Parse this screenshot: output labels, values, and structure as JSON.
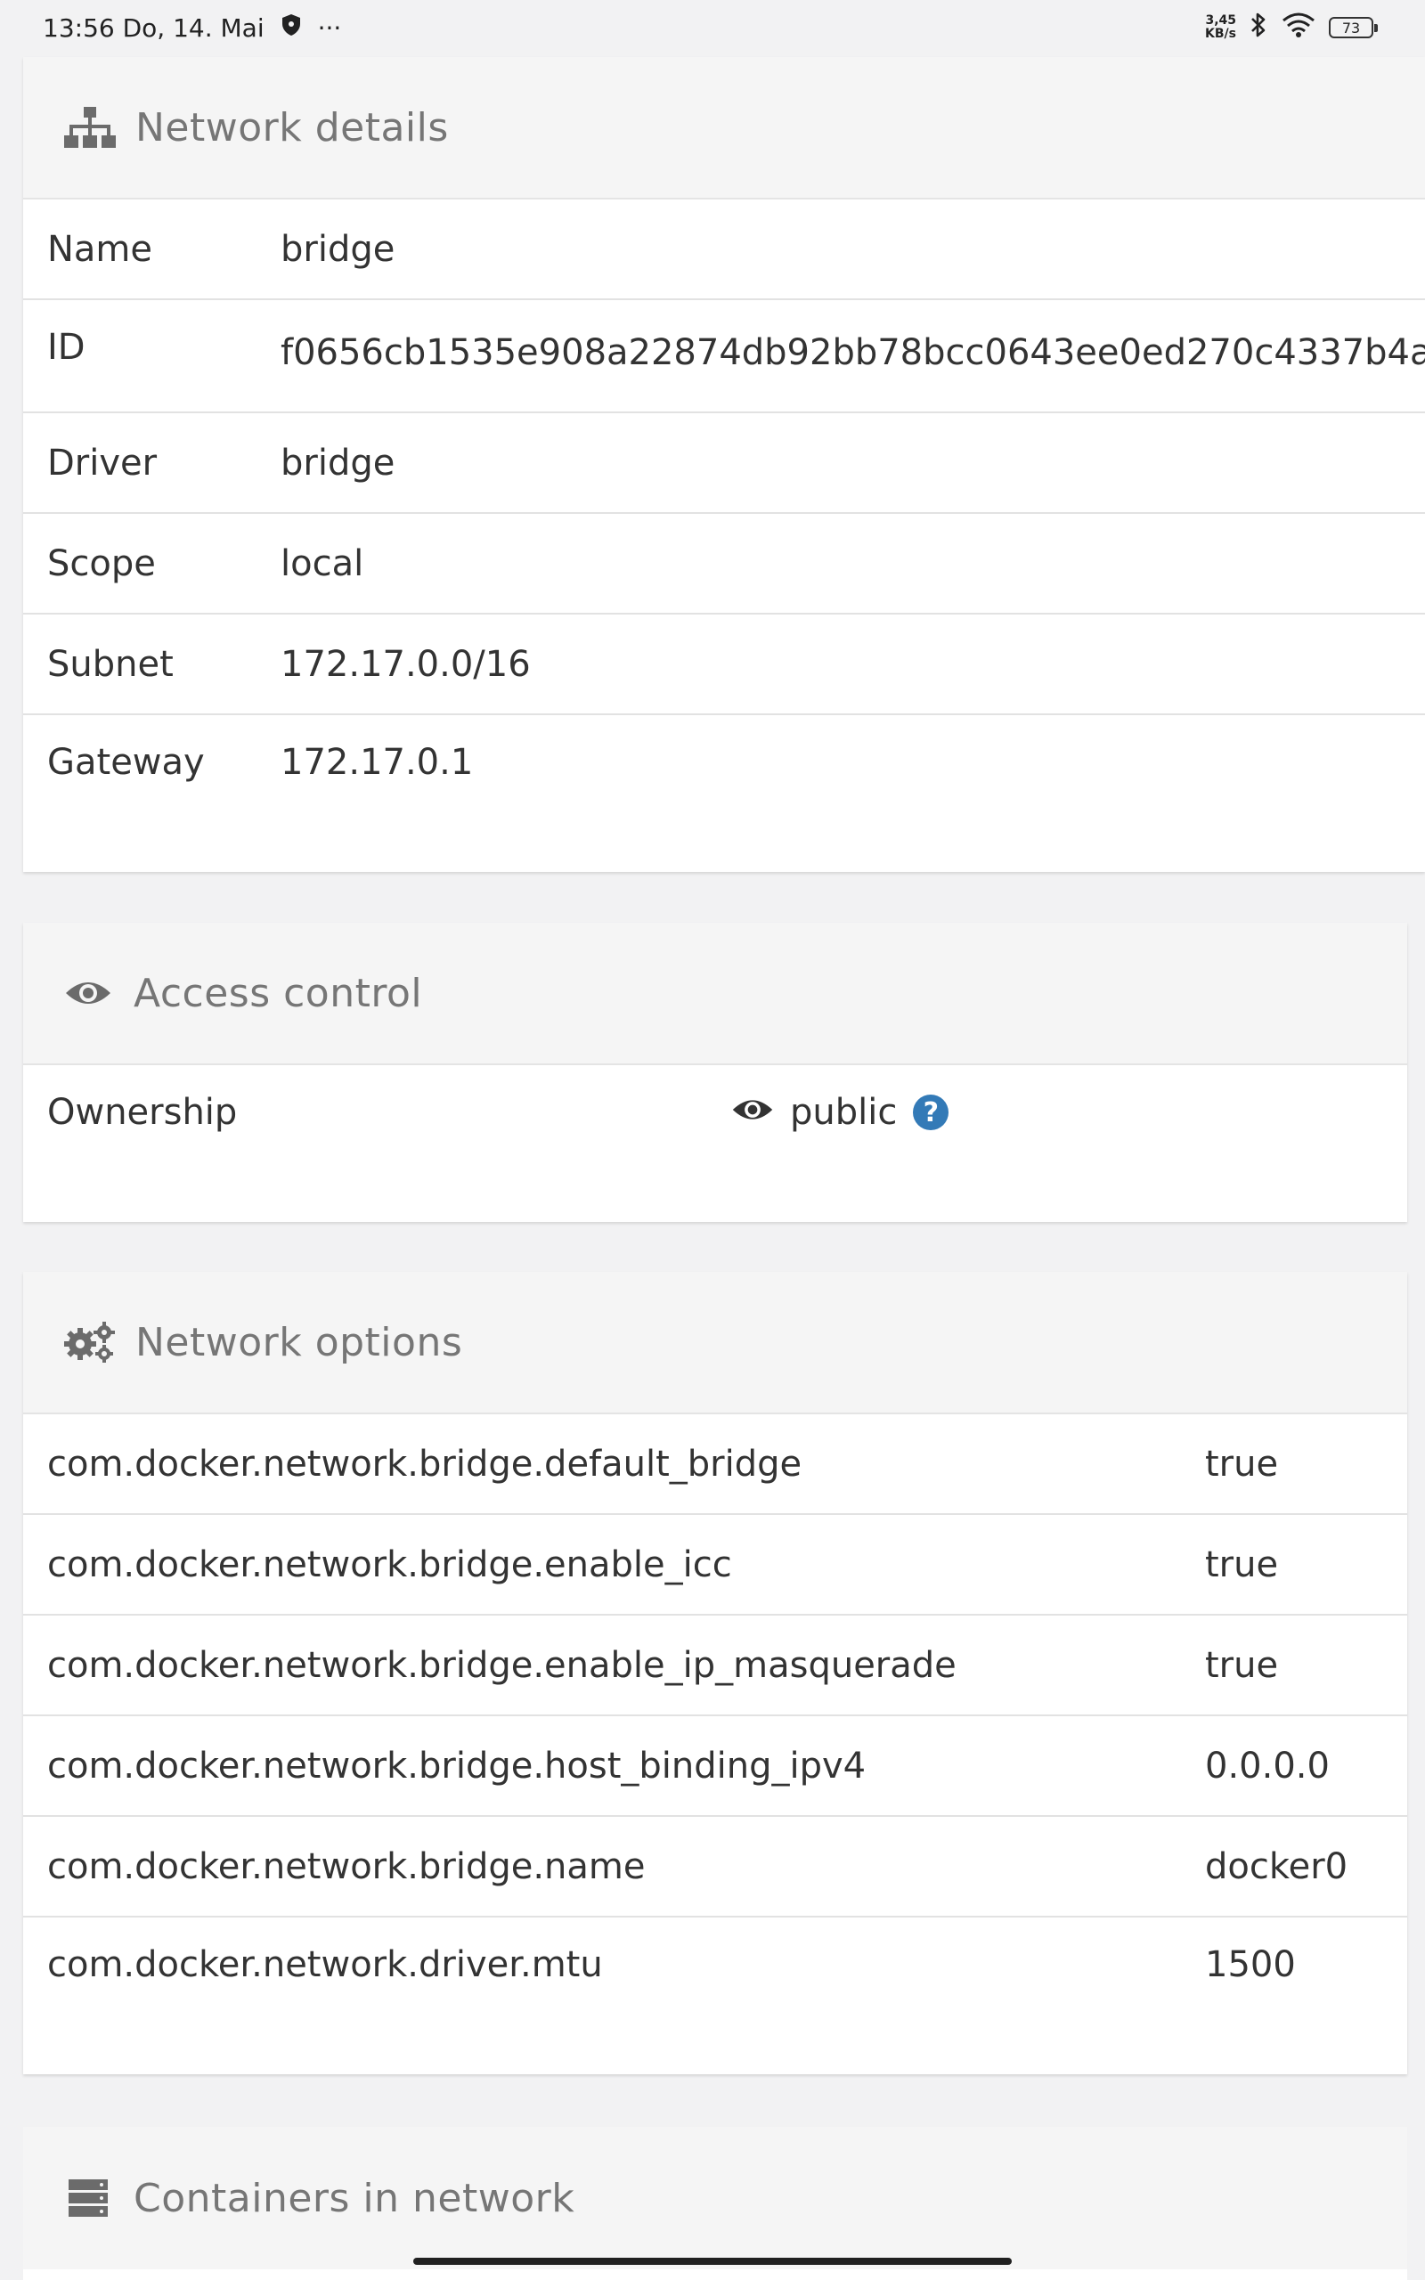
{
  "status_bar": {
    "time_date": "13:56 Do, 14. Mai",
    "more": "···",
    "speed_value": "3,45",
    "speed_unit": "KB/s",
    "battery": "73"
  },
  "network_details": {
    "title": "Network details",
    "icon": "sitemap-icon",
    "rows": [
      {
        "key": "Name",
        "value": "bridge"
      },
      {
        "key": "ID",
        "value": "f0656cb1535e908a22874db92bb78bcc0643ee0ed270c4337b4a"
      },
      {
        "key": "Driver",
        "value": "bridge"
      },
      {
        "key": "Scope",
        "value": "local"
      },
      {
        "key": "Subnet",
        "value": "172.17.0.0/16"
      },
      {
        "key": "Gateway",
        "value": "172.17.0.1"
      }
    ]
  },
  "access_control": {
    "title": "Access control",
    "icon": "eye-icon",
    "ownership_label": "Ownership",
    "ownership_value": "public",
    "help": "?"
  },
  "network_options": {
    "title": "Network options",
    "icon": "cogs-icon",
    "rows": [
      {
        "key": "com.docker.network.bridge.default_bridge",
        "value": "true"
      },
      {
        "key": "com.docker.network.bridge.enable_icc",
        "value": "true"
      },
      {
        "key": "com.docker.network.bridge.enable_ip_masquerade",
        "value": "true"
      },
      {
        "key": "com.docker.network.bridge.host_binding_ipv4",
        "value": "0.0.0.0"
      },
      {
        "key": "com.docker.network.bridge.name",
        "value": "docker0"
      },
      {
        "key": "com.docker.network.driver.mtu",
        "value": "1500"
      }
    ]
  },
  "containers": {
    "title": "Containers in network",
    "icon": "server-icon"
  },
  "colors": {
    "help_badge": "#337ab7",
    "header_text": "#767676",
    "header_bg": "#f5f5f5",
    "page_bg": "#f2f2f3"
  }
}
